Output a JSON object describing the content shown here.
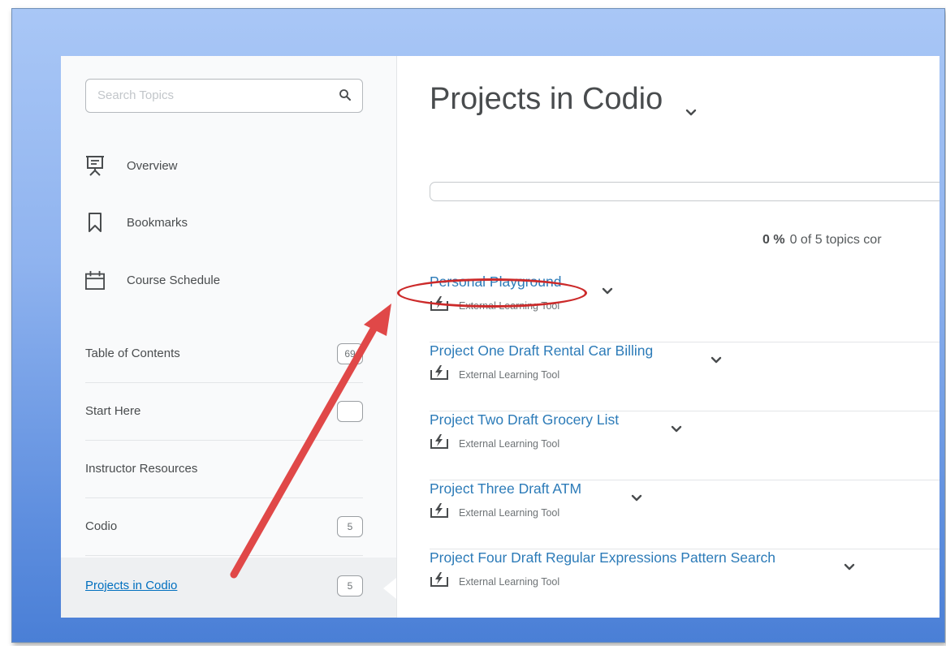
{
  "search": {
    "placeholder": "Search Topics"
  },
  "nav": [
    {
      "label": "Overview",
      "icon": "presentation-icon"
    },
    {
      "label": "Bookmarks",
      "icon": "bookmark-icon"
    },
    {
      "label": "Course Schedule",
      "icon": "calendar-icon"
    }
  ],
  "toc": [
    {
      "label": "Table of Contents",
      "count": "69"
    },
    {
      "label": "Start Here",
      "count": ""
    },
    {
      "label": "Instructor Resources",
      "count": ""
    },
    {
      "label": "Codio",
      "count": "5"
    },
    {
      "label": "Projects in Codio",
      "count": "5",
      "active": true
    }
  ],
  "main": {
    "title": "Projects in Codio",
    "progress": {
      "percent_label": "0 %",
      "summary": "0 of 5 topics cor",
      "value": 0
    },
    "topics": [
      {
        "title": "Personal Playground",
        "type": "External Learning Tool"
      },
      {
        "title": "Project One Draft Rental Car Billing",
        "type": "External Learning Tool"
      },
      {
        "title": "Project Two Draft Grocery List",
        "type": "External Learning Tool"
      },
      {
        "title": "Project Three Draft ATM",
        "type": "External Learning Tool"
      },
      {
        "title": "Project Four Draft Regular Expressions Pattern Search",
        "type": "External Learning Tool"
      }
    ]
  },
  "colors": {
    "link": "#2c7bb8",
    "annotation": "#cc2a2a",
    "frame_top": "#a9c7f6",
    "frame_bottom": "#4a7fd6"
  }
}
